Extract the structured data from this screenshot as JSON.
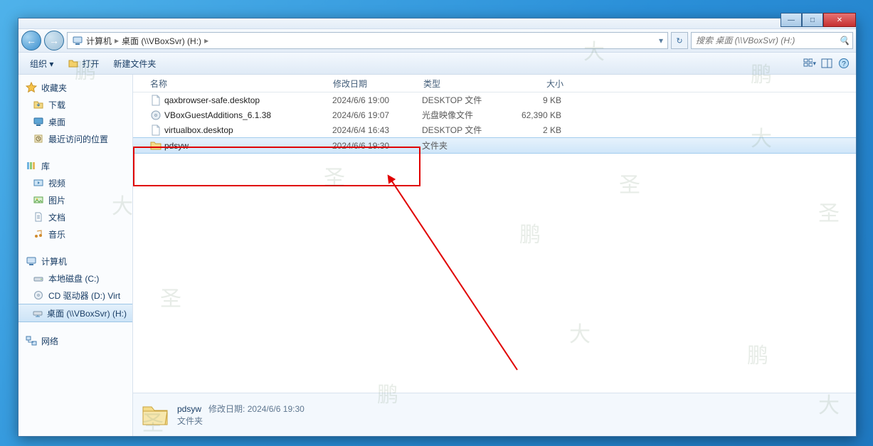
{
  "titlebar": {},
  "nav": {
    "path_root": "计算机",
    "path_leaf": "桌面 (\\\\VBoxSvr) (H:)"
  },
  "search": {
    "placeholder": "搜索 桌面 (\\\\VBoxSvr) (H:)"
  },
  "toolbar": {
    "organize": "组织 ▾",
    "open": "打开",
    "newfolder": "新建文件夹"
  },
  "sidebar": {
    "favorites": "收藏夹",
    "downloads": "下载",
    "desktop": "桌面",
    "recent": "最近访问的位置",
    "libraries": "库",
    "videos": "视频",
    "pictures": "图片",
    "documents": "文档",
    "music": "音乐",
    "computer": "计算机",
    "localdisk": "本地磁盘 (C:)",
    "cddrive": "CD 驱动器 (D:) Virt",
    "netdrive": "桌面 (\\\\VBoxSvr) (H:)",
    "network": "网络"
  },
  "columns": {
    "name": "名称",
    "date": "修改日期",
    "type": "类型",
    "size": "大小"
  },
  "files": [
    {
      "name": "qaxbrowser-safe.desktop",
      "date": "2024/6/6 19:00",
      "type": "DESKTOP 文件",
      "size": "9 KB",
      "icon": "file"
    },
    {
      "name": "VBoxGuestAdditions_6.1.38",
      "date": "2024/6/6 19:07",
      "type": "光盘映像文件",
      "size": "62,390 KB",
      "icon": "disc"
    },
    {
      "name": "virtualbox.desktop",
      "date": "2024/6/4 16:43",
      "type": "DESKTOP 文件",
      "size": "2 KB",
      "icon": "file"
    },
    {
      "name": "pdsyw",
      "date": "2024/6/6 19:30",
      "type": "文件夹",
      "size": "",
      "icon": "folder",
      "selected": true
    }
  ],
  "details": {
    "name": "pdsyw",
    "datelabel": "修改日期:",
    "date": "2024/6/6 19:30",
    "type": "文件夹"
  },
  "watermarks": [
    "鹏",
    "大",
    "圣"
  ]
}
